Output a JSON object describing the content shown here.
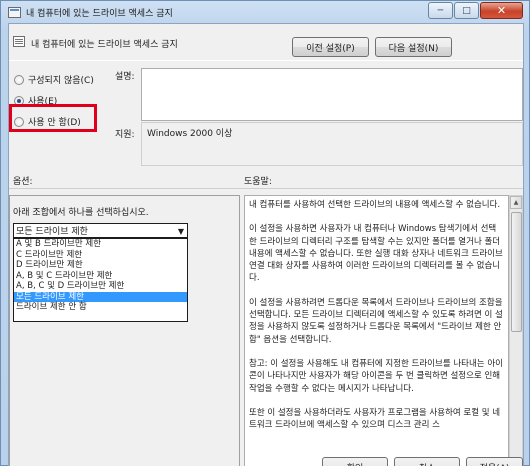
{
  "window": {
    "title": "내 컴퓨터에 있는 드라이브 액세스 금지",
    "minimize_glyph": "─",
    "maximize_glyph": "□",
    "close_glyph": "✕"
  },
  "header": {
    "title": "내 컴퓨터에 있는 드라이브 액세스 금지",
    "prev_button": "이전 설정(P)",
    "next_button": "다음 설정(N)"
  },
  "state_options": [
    {
      "label": "구성되지 않음(C)",
      "checked": false
    },
    {
      "label": "사용(E)",
      "checked": true
    },
    {
      "label": "사용 안 함(D)",
      "checked": false
    }
  ],
  "comment_label": "설명:",
  "supported_label": "지원:",
  "supported_value": "Windows 2000 이상",
  "options_label": "옵션:",
  "help_label": "도움말:",
  "options": {
    "prompt": "아래 조합에서 하나를 선택하십시오.",
    "selected": "모든 드라이브 제한",
    "items": [
      "A 및 B 드라이브만 제한",
      "C 드라이브만 제한",
      "D 드라이브만 제한",
      "A, B 및 C 드라이브만 제한",
      "A, B, C 및 D 드라이브만 제한",
      "모든 드라이브 제한",
      "드라이브 제한 안 함"
    ],
    "highlighted_index": 5
  },
  "help_paragraphs": [
    "내 컴퓨터를 사용하여 선택한 드라이브의 내용에 액세스할 수 없습니다.",
    "이 설정을 사용하면 사용자가 내 컴퓨터나 Windows 탐색기에서 선택한 드라이브의 디렉터리 구조를 탐색할 수는 있지만 폴더를 열거나 폴더 내용에 액세스할 수 없습니다. 또한 실행 대화 상자나 네트워크 드라이브 연결 대화 상자를 사용하여 이러한 드라이브의 디렉터리를 볼 수 없습니다.",
    "이 설정을 사용하려면 드롭다운 목록에서 드라이브나 드라이브의 조합을 선택합니다. 모든 드라이브 디렉터리에 액세스할 수 있도록 하려면 이 설정을 사용하지 않도록 설정하거나 드롭다운 목록에서 \"드라이브 제한 안 함\" 옵션을 선택합니다.",
    "참고: 이 설정을 사용해도 내 컴퓨터에 지정한 드라이브를 나타내는 아이콘이 나타나지만 사용자가 해당 아이콘을 두 번 클릭하면 설정으로 인해 작업을 수행할 수 없다는 메시지가 나타납니다.",
    "또한 이 설정을 사용하더라도 사용자가 프로그램을 사용하여 로컬 및 네트워크 드라이브에 액세스할 수 있으며 디스크 관리 스"
  ],
  "footer": {
    "ok_button": "확인",
    "cancel_button": "취소",
    "apply_button": "적용(A)"
  },
  "colors": {
    "highlight": "#3399ff",
    "annotation_box": "#e0001b"
  }
}
